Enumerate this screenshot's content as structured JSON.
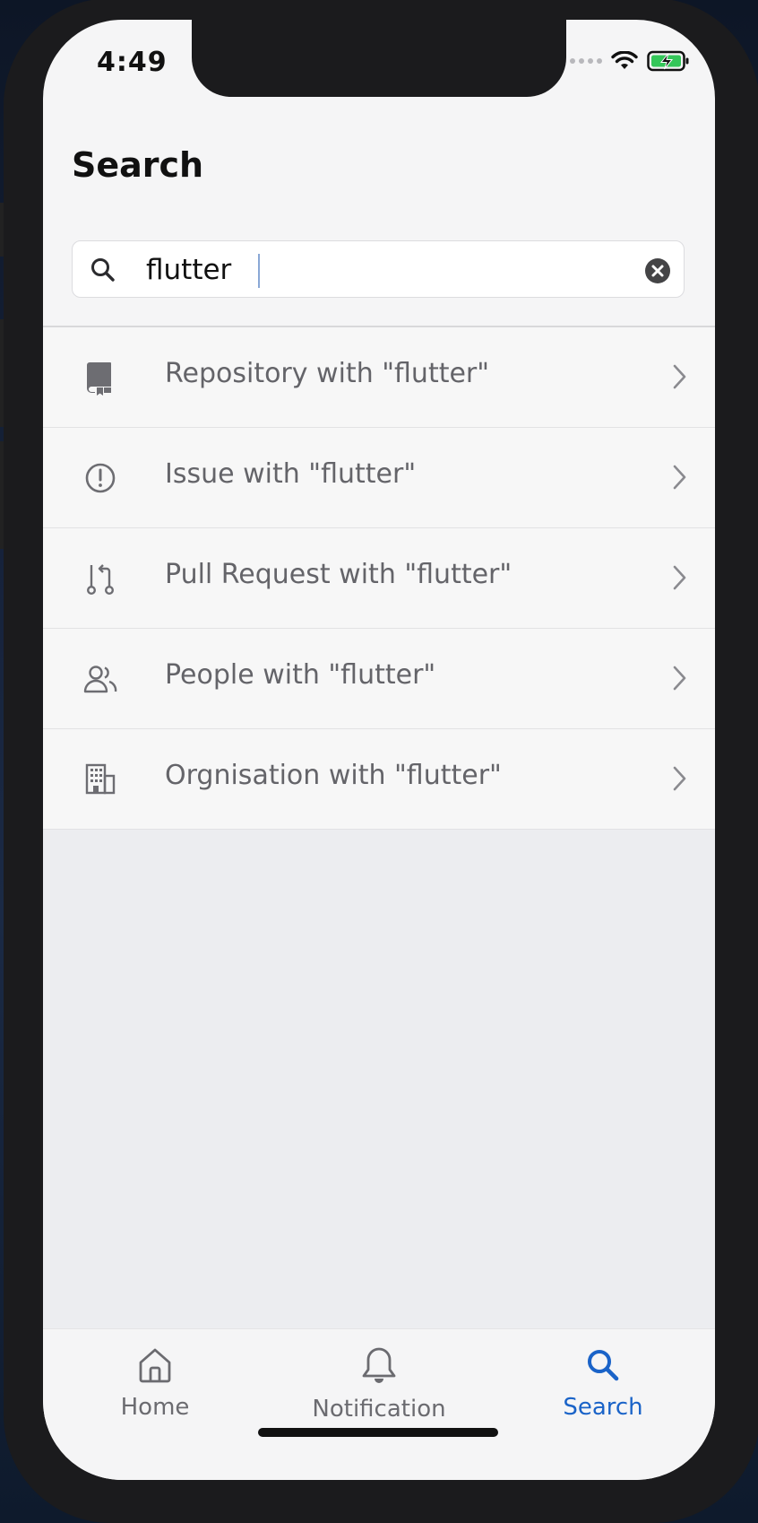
{
  "status_bar": {
    "time": "4:49"
  },
  "header": {
    "title": "Search"
  },
  "search": {
    "value": "flutter",
    "placeholder": ""
  },
  "results": [
    {
      "label": "Repository with \"flutter\"",
      "icon": "repository-icon"
    },
    {
      "label": "Issue with \"flutter\"",
      "icon": "issue-icon"
    },
    {
      "label": "Pull Request with \"flutter\"",
      "icon": "pull-request-icon"
    },
    {
      "label": "People with \"flutter\"",
      "icon": "people-icon"
    },
    {
      "label": "Orgnisation with \"flutter\"",
      "icon": "organisation-icon"
    }
  ],
  "tabbar": {
    "tabs": [
      {
        "label": "Home",
        "icon": "home-icon",
        "active": false
      },
      {
        "label": "Notification",
        "icon": "bell-icon",
        "active": false
      },
      {
        "label": "Search",
        "icon": "search-icon",
        "active": true
      }
    ]
  },
  "colors": {
    "accent": "#1a63c8",
    "battery": "#34c759"
  }
}
